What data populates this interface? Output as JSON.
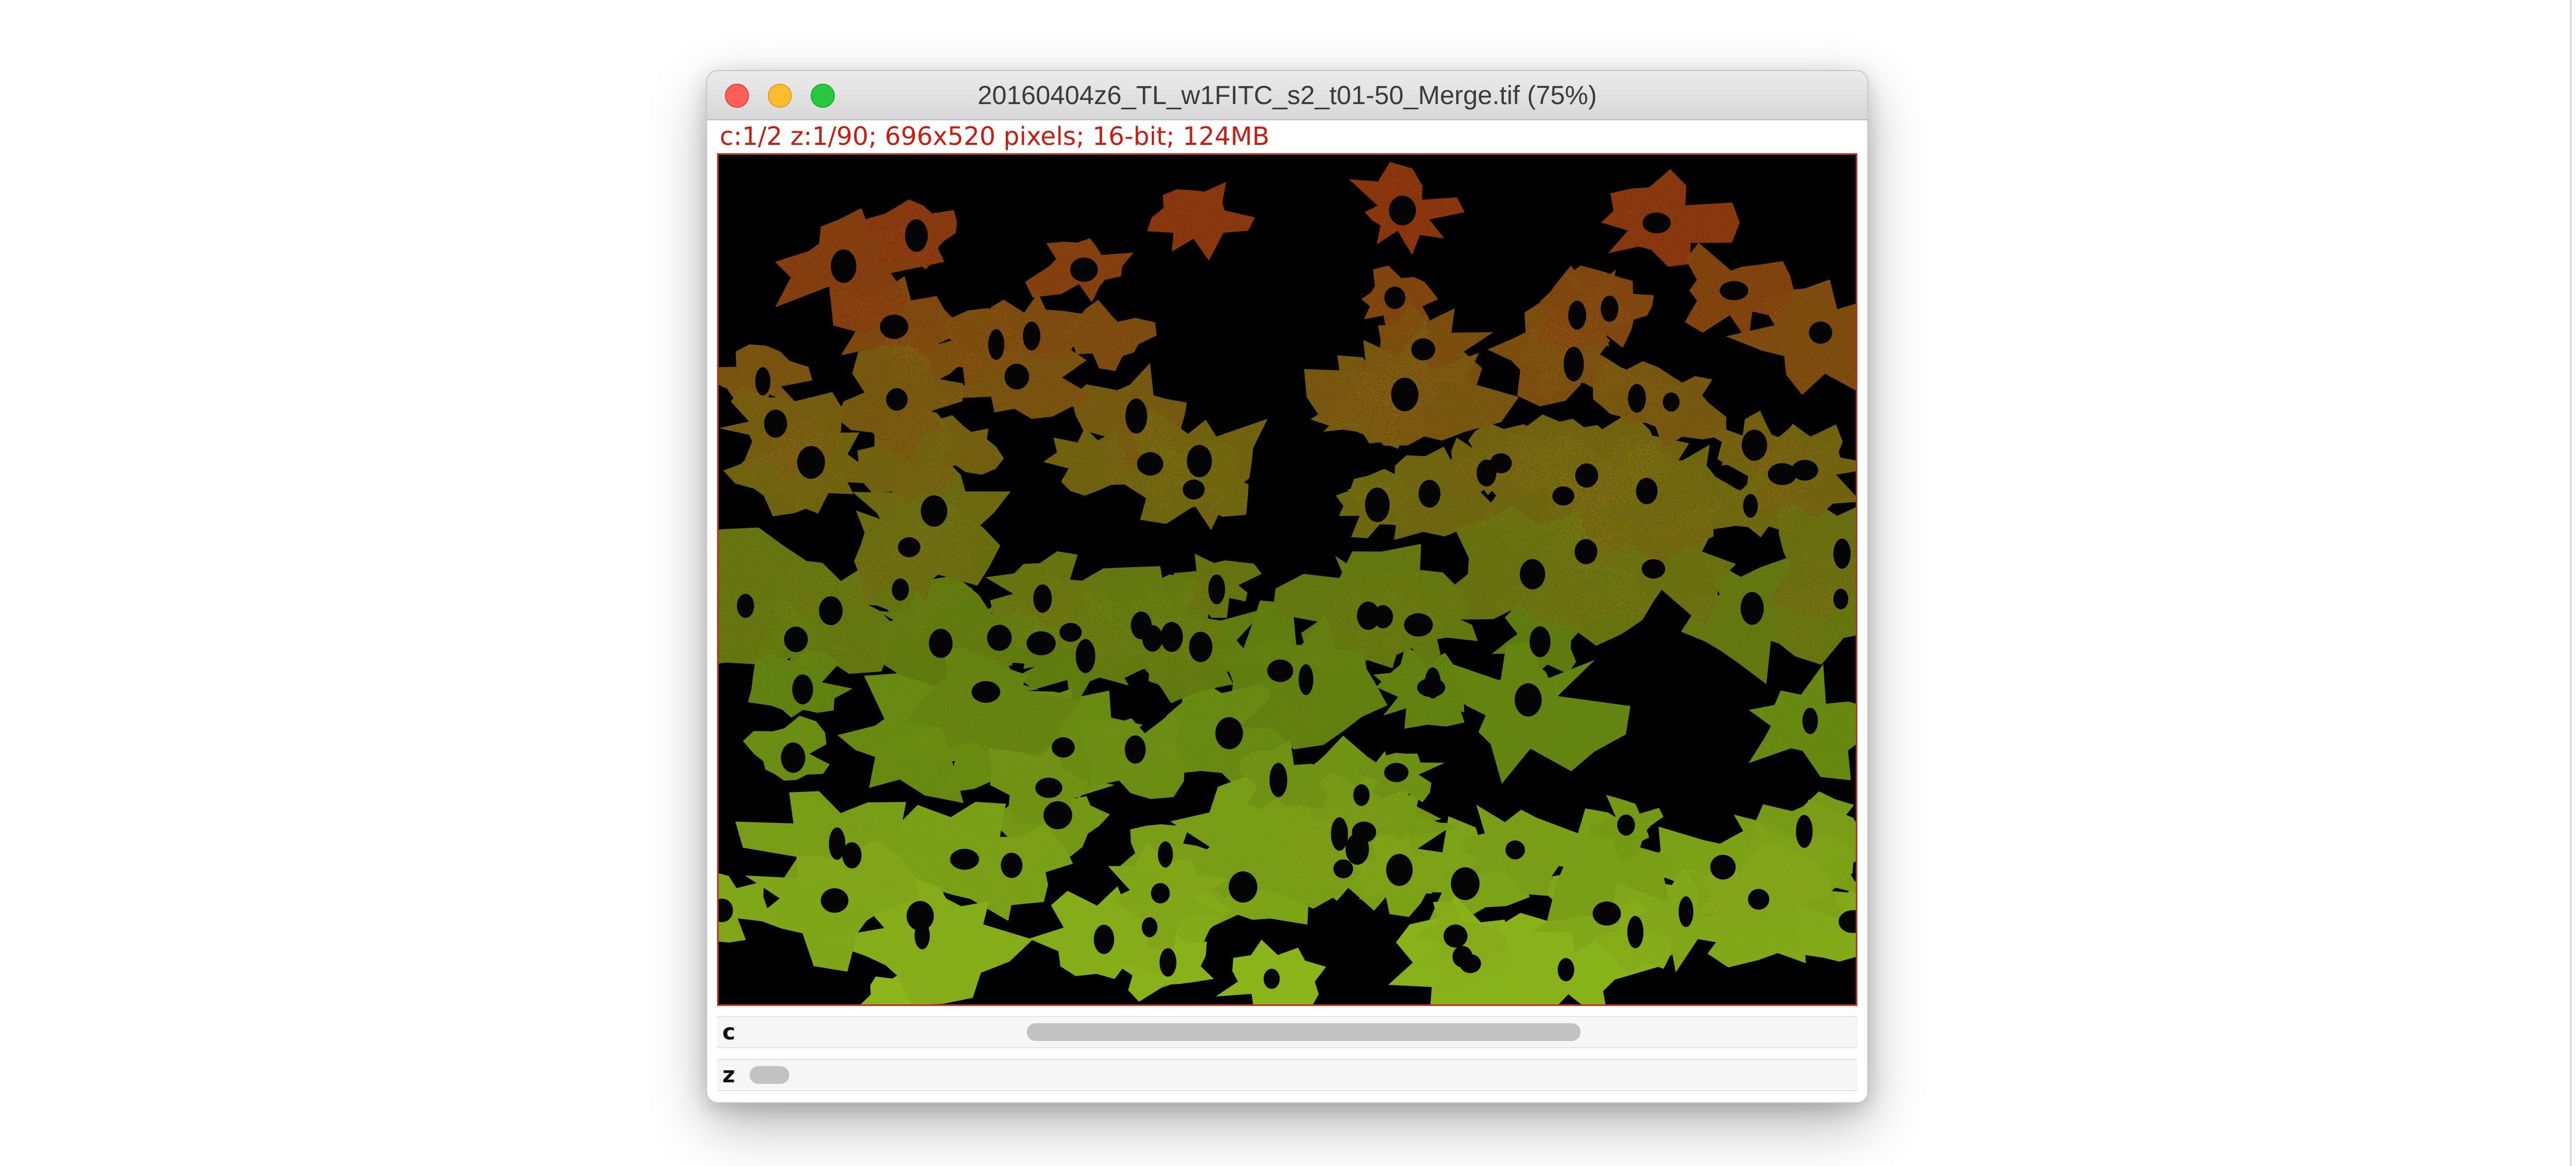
{
  "window": {
    "title": "20160404z6_TL_w1FITC_s2_t01-50_Merge.tif (75%)",
    "info": "c:1/2 z:1/90; 696x520 pixels; 16-bit; 124MB",
    "buttons": {
      "close": "close-button",
      "minimize": "minimize-button",
      "zoom": "zoom-button"
    }
  },
  "image": {
    "description_colors": {
      "background": "#000000",
      "channel_red": "#c83214",
      "channel_green": "#7aa81e",
      "border": "#d0281c"
    }
  },
  "sliders": {
    "c": {
      "label": "c",
      "position": 0.5,
      "thumb_fraction": 0.5
    },
    "z": {
      "label": "z",
      "position": 0.0,
      "thumb_fraction": 0.036
    }
  }
}
